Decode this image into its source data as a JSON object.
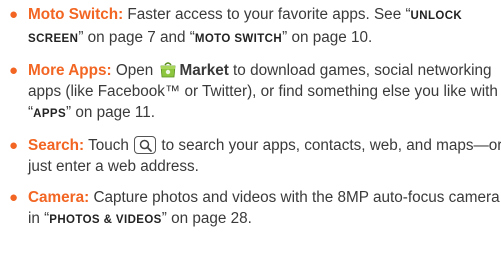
{
  "colors": {
    "accent": "#f26522",
    "text": "#3a3a3a"
  },
  "items": [
    {
      "term": "Moto Switch:",
      "t1": " Faster access to your favorite apps. See “",
      "x1": "unlock screen",
      "t2": "” on page 7 and “",
      "x2": "moto switch",
      "t3": "” on page 10."
    },
    {
      "term": "More Apps:",
      "t1": " Open ",
      "icon": "market-icon",
      "app": "Market",
      "t2": " to download games, social networking apps (like Facebook™ or Twitter), or find something else you like with “",
      "x1": "apps",
      "t3": "” on page 11."
    },
    {
      "term": "Search:",
      "t1": " Touch ",
      "icon": "search-key-icon",
      "t2": " to search your apps, contacts, web, and maps—or just enter a web address."
    },
    {
      "term": "Camera:",
      "t1": " Capture photos and videos with the 8MP auto-focus camera in “",
      "x1": "photos & videos",
      "t2": "” on page 28."
    }
  ]
}
